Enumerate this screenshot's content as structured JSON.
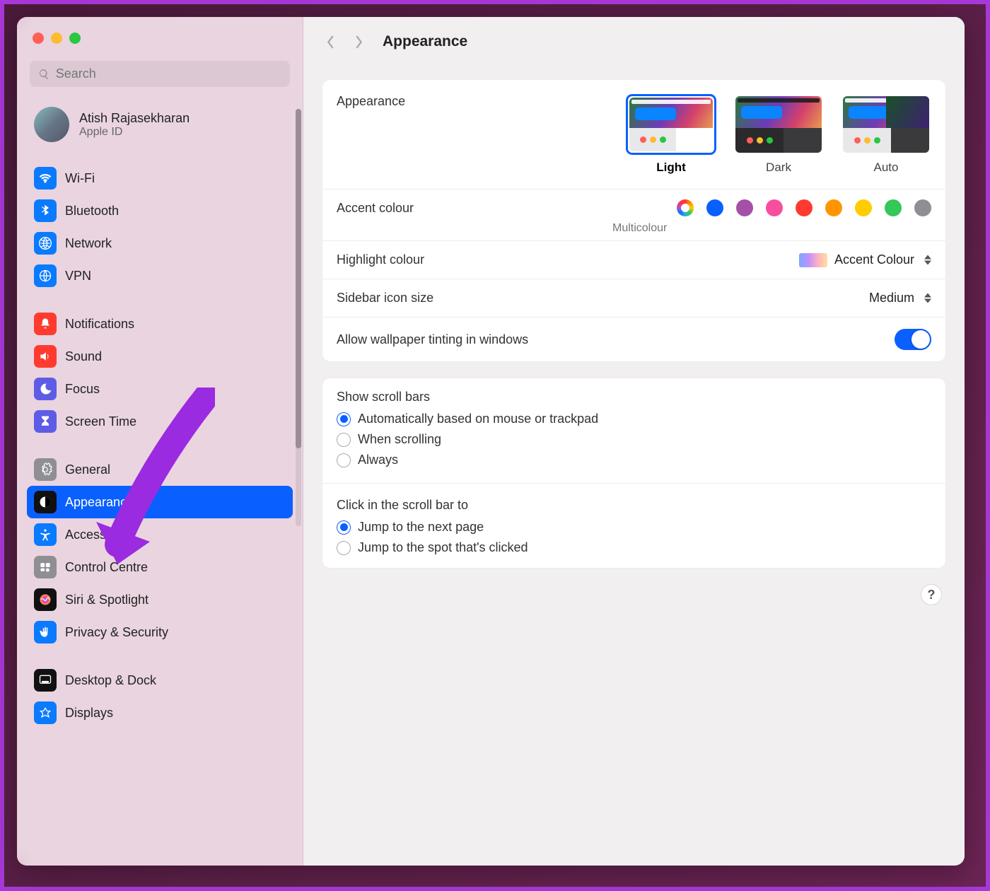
{
  "window": {
    "title": "Appearance"
  },
  "search": {
    "placeholder": "Search"
  },
  "profile": {
    "name": "Atish Rajasekharan",
    "sub": "Apple ID"
  },
  "sidebar": {
    "groups": [
      [
        {
          "label": "Wi-Fi",
          "icon": "wifi",
          "color": "#0a7aff"
        },
        {
          "label": "Bluetooth",
          "icon": "bluetooth",
          "color": "#0a7aff"
        },
        {
          "label": "Network",
          "icon": "network",
          "color": "#0a7aff"
        },
        {
          "label": "VPN",
          "icon": "vpn",
          "color": "#0a7aff"
        }
      ],
      [
        {
          "label": "Notifications",
          "icon": "bell",
          "color": "#ff3b30"
        },
        {
          "label": "Sound",
          "icon": "sound",
          "color": "#ff3b30"
        },
        {
          "label": "Focus",
          "icon": "moon",
          "color": "#5e5ce6"
        },
        {
          "label": "Screen Time",
          "icon": "hourglass",
          "color": "#5e5ce6"
        }
      ],
      [
        {
          "label": "General",
          "icon": "gear",
          "color": "#8e8e93"
        },
        {
          "label": "Appearance",
          "icon": "appearance",
          "color": "#111",
          "selected": true
        },
        {
          "label": "Accessibility",
          "icon": "accessibility",
          "color": "#0a7aff"
        },
        {
          "label": "Control Centre",
          "icon": "control",
          "color": "#8e8e93"
        },
        {
          "label": "Siri & Spotlight",
          "icon": "siri",
          "color": "#111"
        },
        {
          "label": "Privacy & Security",
          "icon": "hand",
          "color": "#0a7aff"
        }
      ],
      [
        {
          "label": "Desktop & Dock",
          "icon": "dock",
          "color": "#111"
        },
        {
          "label": "Displays",
          "icon": "displays",
          "color": "#0a7aff"
        }
      ]
    ]
  },
  "main": {
    "appearance_label": "Appearance",
    "appearance_options": [
      {
        "label": "Light",
        "selected": true
      },
      {
        "label": "Dark"
      },
      {
        "label": "Auto"
      }
    ],
    "accent_label": "Accent colour",
    "accent_sub": "Multicolour",
    "accent_colors": [
      "multi",
      "#0a60ff",
      "#a550a7",
      "#f74f9e",
      "#ff3b30",
      "#ff9500",
      "#ffcc00",
      "#34c759",
      "#8e8e93"
    ],
    "highlight_label": "Highlight colour",
    "highlight_value": "Accent Colour",
    "sidebar_size_label": "Sidebar icon size",
    "sidebar_size_value": "Medium",
    "tinting_label": "Allow wallpaper tinting in windows",
    "tinting_on": true,
    "scroll_title": "Show scroll bars",
    "scroll_opts": [
      {
        "label": "Automatically based on mouse or trackpad",
        "on": true
      },
      {
        "label": "When scrolling"
      },
      {
        "label": "Always"
      }
    ],
    "click_title": "Click in the scroll bar to",
    "click_opts": [
      {
        "label": "Jump to the next page",
        "on": true
      },
      {
        "label": "Jump to the spot that's clicked"
      }
    ],
    "help": "?"
  }
}
